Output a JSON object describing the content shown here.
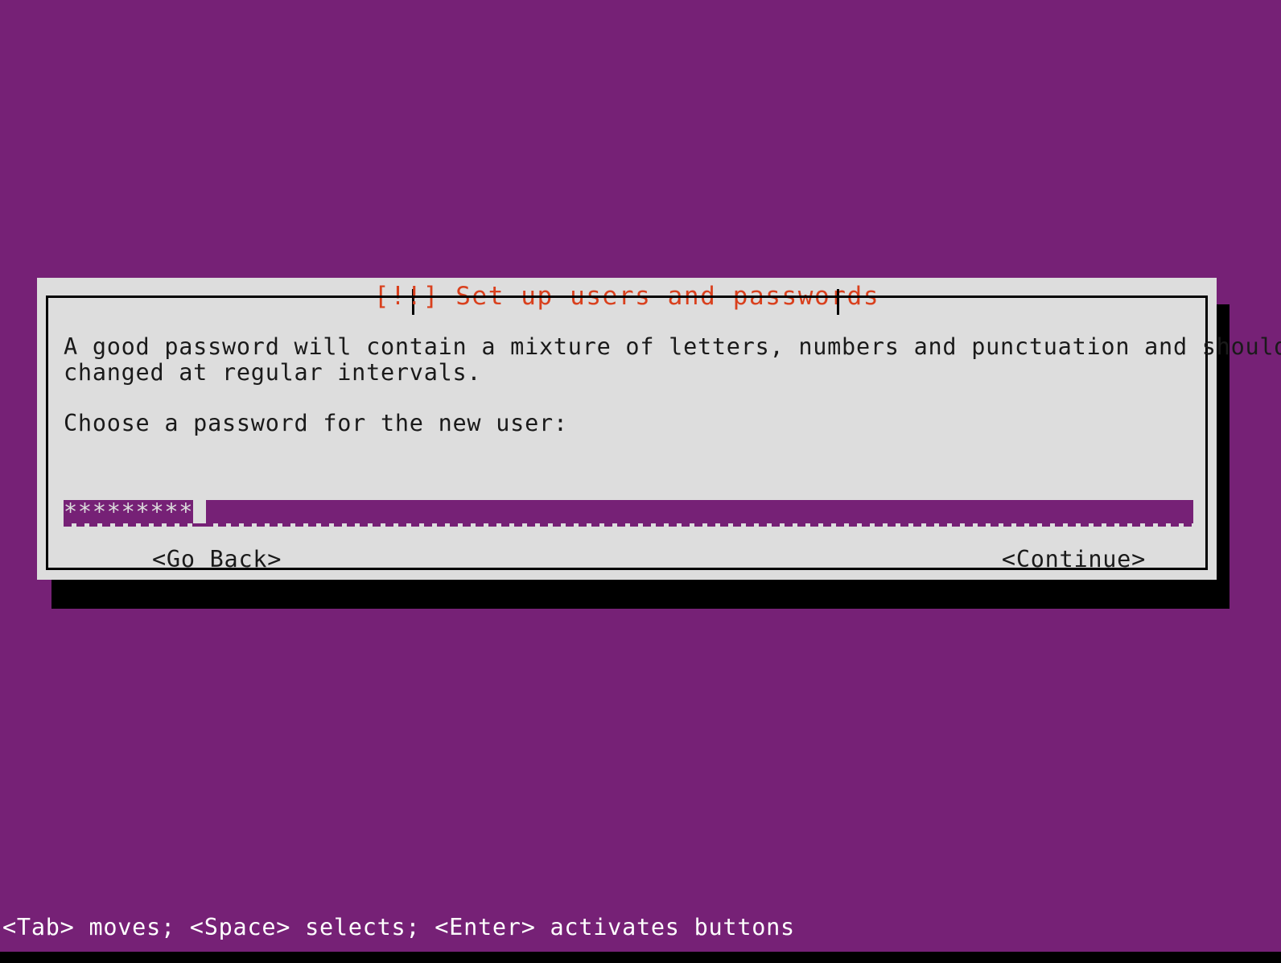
{
  "screen": {
    "background_color": "#762176",
    "foreground_color": "#ffffff"
  },
  "dialog": {
    "title": "[!!] Set up users and passwords",
    "title_color": "#d9401d",
    "background_color": "#dddddd",
    "border_color": "#000000",
    "intro_text": "A good password will contain a mixture of letters, numbers and punctuation and should be\nchanged at regular intervals.",
    "prompt_text": "Choose a password for the new user:",
    "password_field": {
      "name": "password",
      "masked_value": "*********",
      "mask_character": "*",
      "character_count": 9,
      "placeholder": "",
      "focused": true,
      "field_color": "#762176",
      "text_color": "#dddddd",
      "cursor_visible": true
    },
    "buttons": {
      "go_back": "<Go Back>",
      "continue": "<Continue>"
    }
  },
  "footer": {
    "hint": "<Tab> moves; <Space> selects; <Enter> activates buttons"
  }
}
